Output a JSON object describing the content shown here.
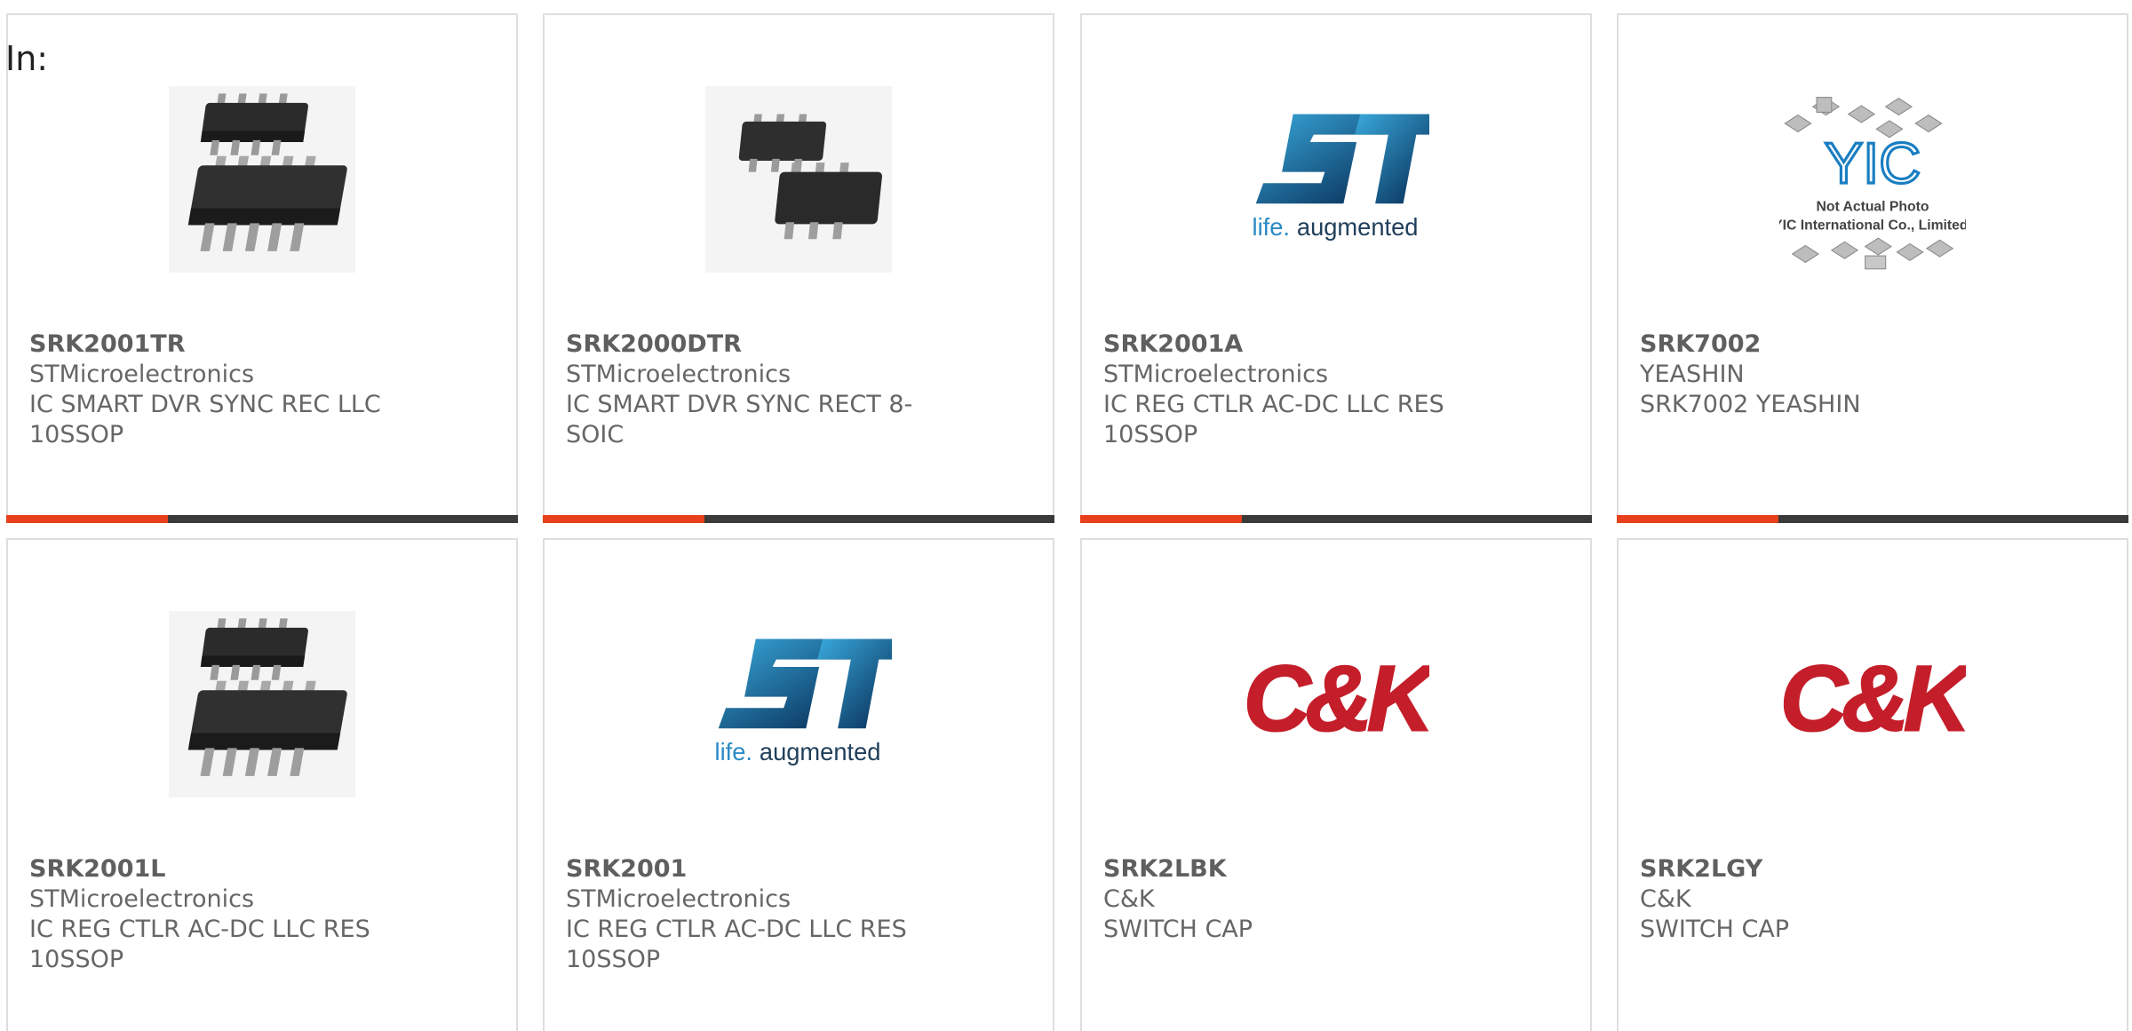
{
  "filter_label": "In:",
  "accent_color": "#e8401c",
  "bar_color": "#3a3a3a",
  "products": [
    {
      "part": "SRK2001TR",
      "maker": "STMicroelectronics",
      "desc1": "IC SMART DVR SYNC REC LLC",
      "desc2": "10SSOP",
      "image": "ic-package-10ssop"
    },
    {
      "part": "SRK2000DTR",
      "maker": "STMicroelectronics",
      "desc1": "IC SMART DVR SYNC RECT 8-",
      "desc2": "SOIC",
      "image": "ic-package-8soic"
    },
    {
      "part": "SRK2001A",
      "maker": "STMicroelectronics",
      "desc1": "IC REG CTLR AC-DC LLC RES",
      "desc2": "10SSOP",
      "image": "st-logo",
      "logo_tagline": "life.augmented"
    },
    {
      "part": "SRK7002",
      "maker": "YEASHIN",
      "desc1": "SRK7002 YEASHIN",
      "desc2": "",
      "image": "yic-not-actual-photo",
      "logo_text": "YIC",
      "logo_line1": "Not Actual Photo",
      "logo_line2": "YIC International Co., Limited."
    },
    {
      "part": "SRK2001L",
      "maker": "STMicroelectronics",
      "desc1": "IC REG CTLR AC-DC LLC RES",
      "desc2": "10SSOP",
      "image": "ic-package-10ssop"
    },
    {
      "part": "SRK2001",
      "maker": "STMicroelectronics",
      "desc1": "IC REG CTLR AC-DC LLC RES",
      "desc2": "10SSOP",
      "image": "st-logo",
      "logo_tagline": "life.augmented"
    },
    {
      "part": "SRK2LBK",
      "maker": "C&K",
      "desc1": "SWITCH CAP",
      "desc2": "",
      "image": "ck-logo",
      "logo_text": "C&K"
    },
    {
      "part": "SRK2LGY",
      "maker": "C&K",
      "desc1": "SWITCH CAP",
      "desc2": "",
      "image": "ck-logo",
      "logo_text": "C&K"
    }
  ]
}
